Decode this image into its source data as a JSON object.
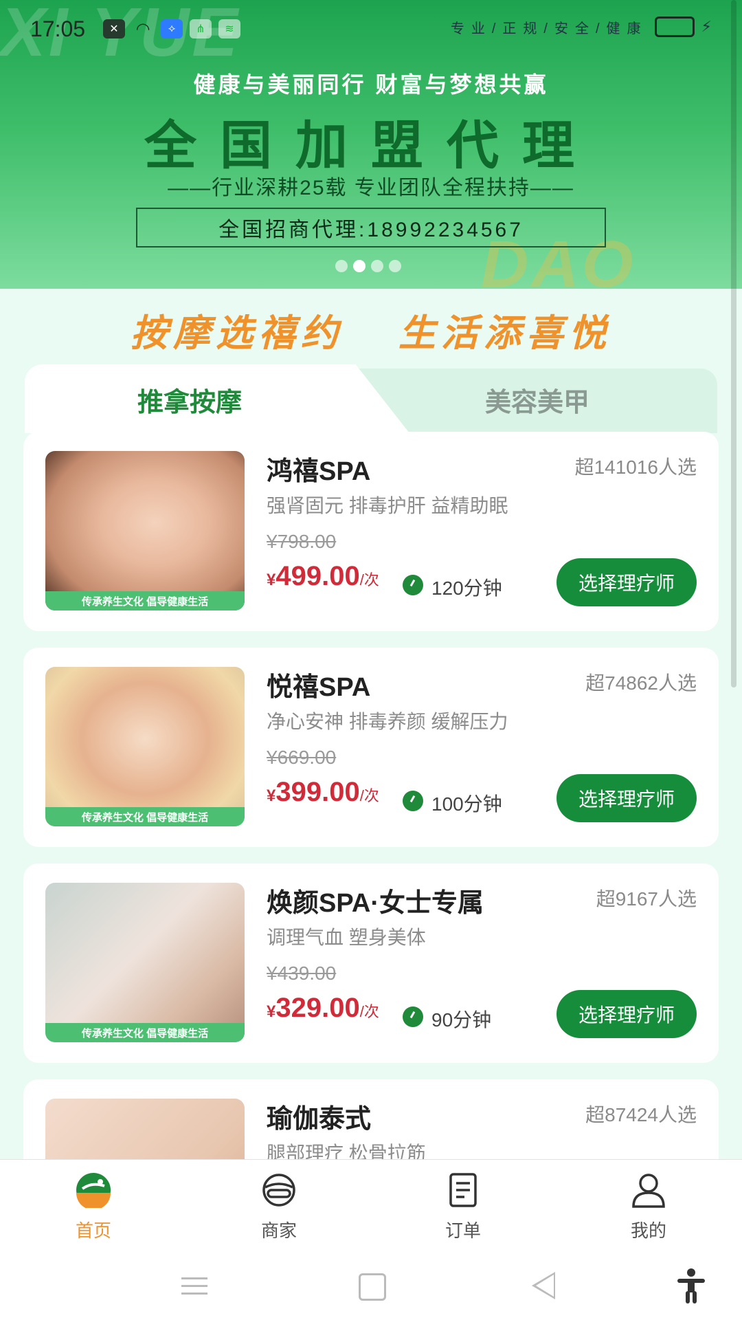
{
  "status": {
    "time": "17:05",
    "right_text": "专业/正规/安全/健康"
  },
  "banner": {
    "watermark_top": "XI YUE",
    "watermark_bottom": "DAO JIA",
    "subtitle": "健康与美丽同行 财富与梦想共赢",
    "title": "全国加盟代理",
    "tagline": "——行业深耕25载 专业团队全程扶持——",
    "phone_box": "全国招商代理:18992234567",
    "dots_total": 4,
    "dots_active": 2
  },
  "slogan": {
    "left": "按摩选禧约",
    "right": "生活添喜悦"
  },
  "tabs": [
    {
      "label": "推拿按摩",
      "active": true
    },
    {
      "label": "美容美甲",
      "active": false
    }
  ],
  "services": [
    {
      "name": "鸿禧SPA",
      "count": "超141016人选",
      "desc": "强肾固元 排毒护肝 益精助眠",
      "original_price": "¥798.00",
      "price_symbol": "¥",
      "price": "499.00",
      "unit": "/次",
      "duration": "120分钟",
      "button": "选择理疗师",
      "thumb_caption": "传承养生文化 倡导健康生活"
    },
    {
      "name": "悦禧SPA",
      "count": "超74862人选",
      "desc": "净心安神 排毒养颜 缓解压力",
      "original_price": "¥669.00",
      "price_symbol": "¥",
      "price": "399.00",
      "unit": "/次",
      "duration": "100分钟",
      "button": "选择理疗师",
      "thumb_caption": "传承养生文化 倡导健康生活"
    },
    {
      "name": "焕颜SPA·女士专属",
      "count": "超9167人选",
      "desc": "调理气血 塑身美体",
      "original_price": "¥439.00",
      "price_symbol": "¥",
      "price": "329.00",
      "unit": "/次",
      "duration": "90分钟",
      "button": "选择理疗师",
      "thumb_caption": "传承养生文化 倡导健康生活"
    },
    {
      "name": "瑜伽泰式",
      "count": "超87424人选",
      "desc": "腿部理疗 松骨拉筋"
    }
  ],
  "nav": [
    {
      "label": "首页",
      "icon": "home-logo-icon",
      "active": true
    },
    {
      "label": "商家",
      "icon": "merchant-icon",
      "active": false
    },
    {
      "label": "订单",
      "icon": "order-icon",
      "active": false
    },
    {
      "label": "我的",
      "icon": "user-icon",
      "active": false
    }
  ],
  "colors": {
    "accent_green": "#168d3b",
    "price_red": "#d12b3a",
    "slogan_orange": "#f0922b"
  }
}
